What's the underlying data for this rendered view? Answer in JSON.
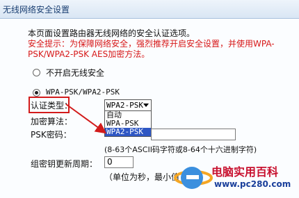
{
  "window": {
    "title": "无线网络安全设置"
  },
  "intro": {
    "line1": "本页面设置路由器无线网络的安全认证选项。",
    "warn1": "安全提示：为保障网络安全，强烈推荐开启安全设置，并使用WPA-",
    "warn2": "PSK/WPA2-PSK AES加密方法。"
  },
  "security": {
    "option_off": "不开启无线安全",
    "option_wpa": "WPA-PSK/WPA2-PSK"
  },
  "form": {
    "auth_label": "认证类型：",
    "auth_selected": "WPA2-PSK",
    "auth_options": [
      "自动",
      "WPA-PSK",
      "WPA2-PSK"
    ],
    "enc_label": "加密算法：",
    "psk_label": "PSK密码：",
    "psk_hint": "(8-63个ASCII码字符或8-64个十六进制字符)",
    "renew_label": "组密钥更新周期：",
    "renew_value": "0",
    "renew_hint": "（单位为秒，最小值"
  },
  "watermark": {
    "name": "电脑实用百科",
    "url": "www.pc280.com"
  },
  "colors": {
    "warning": "#d71818",
    "selected_option": "#2f57c4",
    "annotation": "#d21b1b"
  }
}
